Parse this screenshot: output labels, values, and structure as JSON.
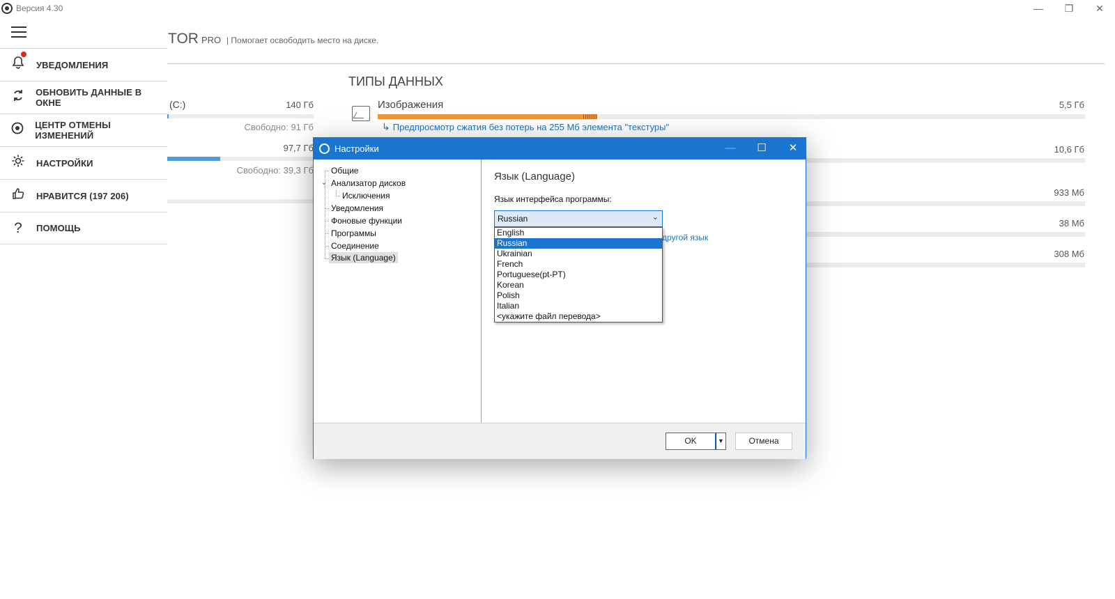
{
  "app": {
    "version": "Версия 4.30",
    "brand": "TOR",
    "brand_edition": "PRO",
    "tagline": "| Помогает освободить место на диске.",
    "window_controls": {
      "minimize": "—",
      "restore": "❐",
      "close": "✕"
    }
  },
  "sidebar": {
    "items": [
      {
        "label": "УВЕДОМЛЕНИЯ",
        "icon": "bell-icon"
      },
      {
        "label": "ОБНОВИТЬ ДАННЫЕ В ОКНЕ",
        "icon": "refresh-icon"
      },
      {
        "label": "ЦЕНТР ОТМЕНЫ ИЗМЕНЕНИЙ",
        "icon": "undo-center-icon"
      },
      {
        "label": "НАСТРОЙКИ",
        "icon": "gear-icon"
      },
      {
        "label": "НРАВИТСЯ (197 206)",
        "icon": "thumbs-up-icon"
      },
      {
        "label": "ПОМОЩЬ",
        "icon": "help-icon"
      }
    ]
  },
  "disks": [
    {
      "label": "(C:)",
      "size": "140 Гб",
      "free": "Свободно: 91 Гб",
      "used_fraction": 0.01
    },
    {
      "label": "",
      "size": "97,7 Гб",
      "free": "Свободно: 39,3 Гб",
      "used_fraction": 0.36
    }
  ],
  "types": {
    "title": "ТИПЫ ДАННЫХ",
    "items": [
      {
        "name": "Изображения",
        "size": "5,5 Гб",
        "fraction": 0.31
      },
      {
        "name": "",
        "size": "10,6 Гб",
        "fraction": 0
      },
      {
        "name": "",
        "size": "933 Мб",
        "fraction": 0
      },
      {
        "name": "",
        "size": "38 Мб",
        "fraction": 0
      },
      {
        "name": "",
        "size": "308 Мб",
        "fraction": 0
      }
    ],
    "preview_link": "Предпросмотр сжатия без потерь на 255 Мб элемента \"текстуры\""
  },
  "dialog": {
    "title": "Настройки",
    "tree": [
      "Общие",
      "Анализатор дисков",
      "Исключения",
      "Уведомления",
      "Фоновые функции",
      "Программы",
      "Соединение",
      "Язык (Language)"
    ],
    "selected_tree_item": "Язык (Language)",
    "panel_title": "Язык (Language)",
    "language_label": "Язык интерфейса программы:",
    "combo_value": "Russian",
    "languages": [
      "English",
      "Russian",
      "Ukrainian",
      "French",
      "Portuguese(pt-PT)",
      "Korean",
      "Polish",
      "Italian",
      "<укажите файл перевода>"
    ],
    "other_language_link": "другой язык",
    "ok_label": "OK",
    "cancel_label": "Отмена"
  }
}
